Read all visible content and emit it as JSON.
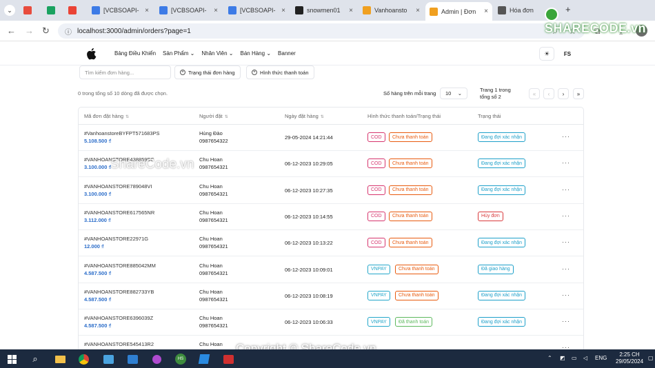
{
  "browser": {
    "tabs": [
      {
        "label": "",
        "color": "#e84c3d"
      },
      {
        "label": "",
        "color": "#1aa260"
      },
      {
        "label": "",
        "color": "#ea4335"
      },
      {
        "label": "[VCBSOAPI-",
        "color": "#3d7be6"
      },
      {
        "label": "[VCBSOAPI-",
        "color": "#3d7be6"
      },
      {
        "label": "[VCBSOAPI-",
        "color": "#3d7be6"
      },
      {
        "label": "snowmen01",
        "color": "#222222"
      },
      {
        "label": "Vanhoansto",
        "color": "#f0a020"
      },
      {
        "label": "Admin | Đơn",
        "color": "#f0a020",
        "active": true
      },
      {
        "label": "Hóa đơn",
        "color": "#555555"
      }
    ],
    "url": "localhost:3000/admin/orders?page=1",
    "logo": "SHARECODE.vn"
  },
  "header": {
    "nav": [
      "Bảng Điều Khiển",
      "Sản Phẩm",
      "Nhân Viên",
      "Bán Hàng",
      "Banner"
    ],
    "user_initials": "FS"
  },
  "toolbar": {
    "search_placeholder": "Tìm kiếm đơn hàng...",
    "filter_status": "Trạng thái đơn hàng",
    "filter_payment": "Hình thức thanh toán"
  },
  "table_info": {
    "selected": "0 trong tổng số 10 dòng đã được chọn.",
    "rows_per_page_label": "Số hàng trên mỗi trang",
    "rows_per_page": "10",
    "page_line1": "Trang 1 trong",
    "page_line2": "tổng số 2"
  },
  "columns": [
    "Mã đơn đặt hàng",
    "Người đặt",
    "Ngày đặt hàng",
    "Hình thức thanh toán/Trạng thái",
    "Trạng thái"
  ],
  "orders": [
    {
      "code": "#VanhoanstoreBYFPT571683PS",
      "amount": "5.108.500 ₫",
      "name": "Hùng Đào",
      "phone": "0987654322",
      "date": "29-05-2024 14:21:44",
      "method": "COD",
      "pay": "Chưa thanh toán",
      "status": "Đang đợi xác nhận"
    },
    {
      "code": "#VANHOANSTORE438859BC",
      "amount": "3.100.000 ₫",
      "name": "Chu Hoan",
      "phone": "0987654321",
      "date": "06-12-2023 10:29:05",
      "method": "COD",
      "pay": "Chưa thanh toán",
      "status": "Đang đợi xác nhận"
    },
    {
      "code": "#VANHOANSTORE789048VI",
      "amount": "3.100.000 ₫",
      "name": "Chu Hoan",
      "phone": "0987654321",
      "date": "06-12-2023 10:27:35",
      "method": "COD",
      "pay": "Chưa thanh toán",
      "status": "Đang đợi xác nhận"
    },
    {
      "code": "#VANHOANSTORE617565NR",
      "amount": "3.112.000 ₫",
      "name": "Chu Hoan",
      "phone": "0987654321",
      "date": "06-12-2023 10:14:55",
      "method": "COD",
      "pay": "Chưa thanh toán",
      "status": "Hủy đơn"
    },
    {
      "code": "#VANHOANSTORE22971G",
      "amount": "12.000 ₫",
      "name": "Chu Hoan",
      "phone": "0987654321",
      "date": "06-12-2023 10:13:22",
      "method": "COD",
      "pay": "Chưa thanh toán",
      "status": "Đang đợi xác nhận"
    },
    {
      "code": "#VANHOANSTORE885042MM",
      "amount": "4.587.500 ₫",
      "name": "Chu Hoan",
      "phone": "0987654321",
      "date": "06-12-2023 10:09:01",
      "method": "VNPAY",
      "pay": "Chưa thanh toán",
      "status": "Đã giao hàng"
    },
    {
      "code": "#VANHOANSTORE882733YB",
      "amount": "4.587.500 ₫",
      "name": "Chu Hoan",
      "phone": "0987654321",
      "date": "06-12-2023 10:08:19",
      "method": "VNPAY",
      "pay": "Chưa thanh toán",
      "status": "Đang đợi xác nhận"
    },
    {
      "code": "#VANHOANSTORE6396039Z",
      "amount": "4.587.500 ₫",
      "name": "Chu Hoan",
      "phone": "0987654321",
      "date": "06-12-2023 10:06:33",
      "method": "VNPAY",
      "pay": "Đã thanh toán",
      "status": "Đang đợi xác nhận"
    },
    {
      "code": "#VANHOANSTORE545413R2",
      "amount": "",
      "name": "Chu Hoan",
      "phone": "",
      "date": "",
      "method": "",
      "pay": "",
      "status": ""
    }
  ],
  "colors": {
    "cod": "#d6336c",
    "vnpay": "#22a6c9",
    "unpaid": "#e8590c",
    "paid": "#5cb85c",
    "pending": "#1c9fc9",
    "cancel": "#d9383a",
    "delivered": "#1c9fc9",
    "amount": "#2a6cc9"
  },
  "watermark": {
    "mid": "ShareCode.vn",
    "bottom": "Copyright © ShareCode.vn"
  },
  "taskbar": {
    "lang": "ENG",
    "time": "2:25 CH",
    "date": "29/05/2024"
  }
}
